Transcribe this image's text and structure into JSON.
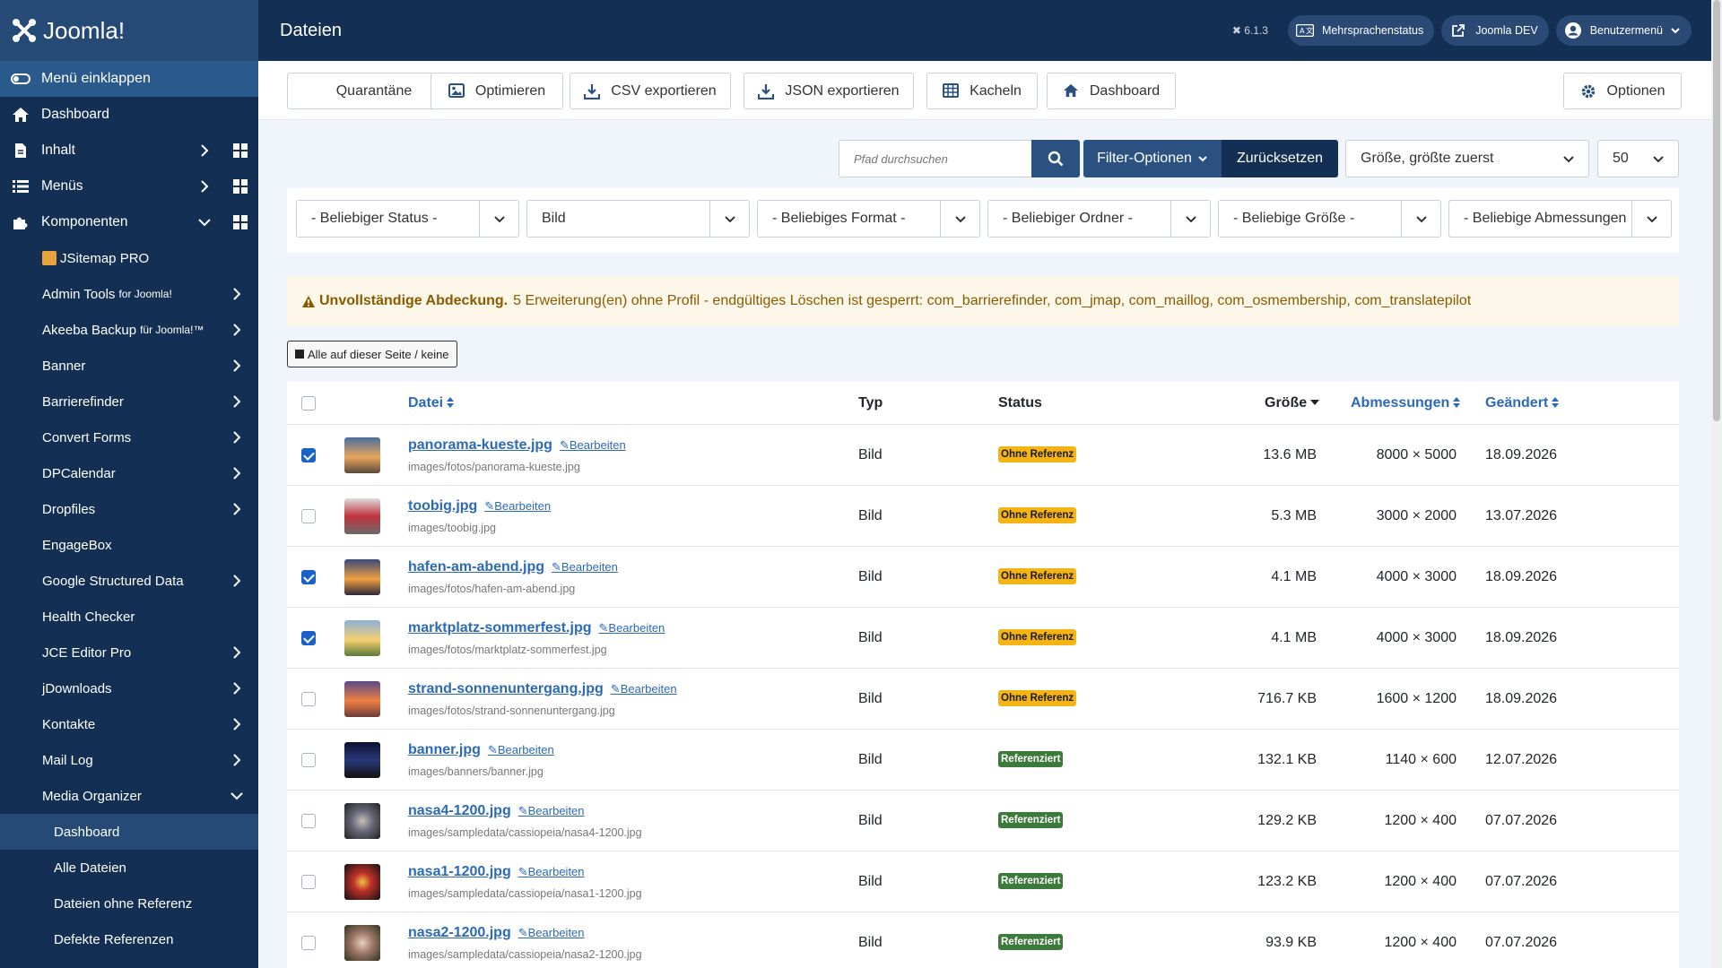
{
  "sidebar": {
    "logo": "Joomla!",
    "collapse_label": "Menü einklappen",
    "top_items": [
      {
        "label": "Dashboard",
        "icon": "home-icon"
      },
      {
        "label": "Inhalt",
        "icon": "file-icon"
      },
      {
        "label": "Menüs",
        "icon": "list-icon"
      },
      {
        "label": "Komponenten",
        "icon": "puzzle-icon"
      }
    ],
    "components": [
      {
        "label": "JSitemap PRO"
      },
      {
        "label": "Admin Tools",
        "small": "for Joomla!"
      },
      {
        "label": "Akeeba Backup",
        "small": "für Joomla!™"
      },
      {
        "label": "Banner"
      },
      {
        "label": "Barrierefinder"
      },
      {
        "label": "Convert Forms"
      },
      {
        "label": "DPCalendar"
      },
      {
        "label": "Dropfiles"
      },
      {
        "label": "EngageBox"
      },
      {
        "label": "Google Structured Data"
      },
      {
        "label": "Health Checker"
      },
      {
        "label": "JCE Editor Pro"
      },
      {
        "label": "jDownloads"
      },
      {
        "label": "Kontakte"
      },
      {
        "label": "Mail Log"
      },
      {
        "label": "Media Organizer"
      }
    ],
    "media_organizer_items": [
      {
        "label": "Dashboard"
      },
      {
        "label": "Alle Dateien"
      },
      {
        "label": "Dateien ohne Referenz"
      },
      {
        "label": "Defekte Referenzen"
      }
    ]
  },
  "header": {
    "title": "Dateien",
    "version": "6.1.3",
    "buttons": [
      {
        "label": "Mehrsprachenstatus"
      },
      {
        "label": "Joomla DEV"
      },
      {
        "label": "Benutzermenü"
      }
    ]
  },
  "toolbar": {
    "quarantine": "Quarantäne",
    "optimize": "Optimieren",
    "csv": "CSV exportieren",
    "json": "JSON exportieren",
    "tiles": "Kacheln",
    "dashboard": "Dashboard",
    "options": "Optionen"
  },
  "search": {
    "placeholder": "Pfad durchsuchen",
    "filter_options": "Filter-Optionen",
    "reset": "Zurücksetzen",
    "sort": "Größe, größte zuerst",
    "limit": "50"
  },
  "filters": [
    "- Beliebiger Status -",
    "Bild",
    "- Beliebiges Format -",
    "- Beliebiger Ordner -",
    "- Beliebige Größe -",
    "- Beliebige Abmessungen"
  ],
  "alert": {
    "title": "Unvollständige Abdeckung.",
    "text": "5 Erweiterung(en) ohne Profil - endgültiges Löschen ist gesperrt: com_barrierefinder, com_jmap, com_maillog, com_osmembership, com_translatepilot"
  },
  "select_all": "Alle auf dieser Seite / keine",
  "table": {
    "columns": {
      "file": "Datei",
      "type": "Typ",
      "status": "Status",
      "size": "Größe",
      "dimensions": "Abmessungen",
      "changed": "Geändert"
    },
    "edit_label": "Bearbeiten",
    "rows": [
      {
        "name": "panorama-kueste.jpg",
        "path": "images/fotos/panorama-kueste.jpg",
        "type": "Bild",
        "status": "Ohne Referenz",
        "status_kind": "warn",
        "size": "13.6 MB",
        "dims": "8000 × 5000",
        "date": "18.09.2026",
        "checked": true,
        "thumb": "sunset-coast"
      },
      {
        "name": "toobig.jpg",
        "path": "images/toobig.jpg",
        "type": "Bild",
        "status": "Ohne Referenz",
        "status_kind": "warn",
        "size": "5.3 MB",
        "dims": "3000 × 2000",
        "date": "13.07.2026",
        "checked": false,
        "thumb": "group-photo"
      },
      {
        "name": "hafen-am-abend.jpg",
        "path": "images/fotos/hafen-am-abend.jpg",
        "type": "Bild",
        "status": "Ohne Referenz",
        "status_kind": "warn",
        "size": "4.1 MB",
        "dims": "4000 × 3000",
        "date": "18.09.2026",
        "checked": true,
        "thumb": "harbour-evening"
      },
      {
        "name": "marktplatz-sommerfest.jpg",
        "path": "images/fotos/marktplatz-sommerfest.jpg",
        "type": "Bild",
        "status": "Ohne Referenz",
        "status_kind": "warn",
        "size": "4.1 MB",
        "dims": "4000 × 3000",
        "date": "18.09.2026",
        "checked": true,
        "thumb": "summer-market"
      },
      {
        "name": "strand-sonnenuntergang.jpg",
        "path": "images/fotos/strand-sonnenuntergang.jpg",
        "type": "Bild",
        "status": "Ohne Referenz",
        "status_kind": "warn",
        "size": "716.7 KB",
        "dims": "1600 × 1200",
        "date": "18.09.2026",
        "checked": false,
        "thumb": "beach-sunset"
      },
      {
        "name": "banner.jpg",
        "path": "images/banners/banner.jpg",
        "type": "Bild",
        "status": "Referenziert",
        "status_kind": "ok",
        "size": "132.1 KB",
        "dims": "1140 × 600",
        "date": "12.07.2026",
        "checked": false,
        "thumb": "night-sky"
      },
      {
        "name": "nasa4-1200.jpg",
        "path": "images/sampledata/cassiopeia/nasa4-1200.jpg",
        "type": "Bild",
        "status": "Referenziert",
        "status_kind": "ok",
        "size": "129.2 KB",
        "dims": "1200 × 400",
        "date": "07.07.2026",
        "checked": false,
        "thumb": "galaxy-grey"
      },
      {
        "name": "nasa1-1200.jpg",
        "path": "images/sampledata/cassiopeia/nasa1-1200.jpg",
        "type": "Bild",
        "status": "Referenziert",
        "status_kind": "ok",
        "size": "123.2 KB",
        "dims": "1200 × 400",
        "date": "07.07.2026",
        "checked": false,
        "thumb": "galaxy-red"
      },
      {
        "name": "nasa2-1200.jpg",
        "path": "images/sampledata/cassiopeia/nasa2-1200.jpg",
        "type": "Bild",
        "status": "Referenziert",
        "status_kind": "ok",
        "size": "93.9 KB",
        "dims": "1200 × 400",
        "date": "07.07.2026",
        "checked": false,
        "thumb": "galaxy-spiral"
      }
    ]
  },
  "colors": {
    "sidebar": "#132f53",
    "accent": "#2a5180",
    "link": "#2a6ab8",
    "warn": "#f5b416",
    "ok": "#3c7a3c"
  }
}
